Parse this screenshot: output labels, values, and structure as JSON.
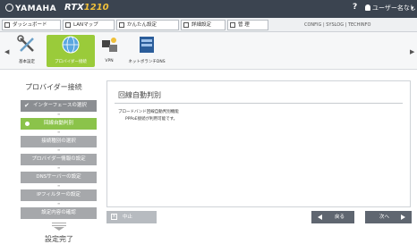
{
  "header": {
    "brand": "YAMAHA",
    "model_prefix": "RTX",
    "model_number": "1210",
    "help": "?",
    "user": "ユーザー名なし",
    "dropdown": "▾"
  },
  "tabs": [
    {
      "label": "ダッシュボード"
    },
    {
      "label": "LANマップ"
    },
    {
      "label": "かんたん設定"
    },
    {
      "label": "詳細設定"
    },
    {
      "label": "管 理"
    }
  ],
  "top_links": "CONFIG | SYSLOG | TECHINFO",
  "toolbar": {
    "items": [
      {
        "label": "基本設定",
        "icon": "wrench-screwdriver-icon"
      },
      {
        "label": "プロバイダー接続",
        "icon": "globe-icon"
      },
      {
        "label": "VPN",
        "icon": "vpn-icon"
      },
      {
        "label": "ネットボランチDNS",
        "icon": "dns-icon"
      }
    ],
    "left_arrow": "◀",
    "right_arrow": "▶"
  },
  "sidebar": {
    "title": "プロバイダー接続",
    "steps": [
      {
        "label": "インターフェースの選択",
        "status": "done"
      },
      {
        "label": "回線自動判別",
        "status": "current"
      },
      {
        "label": "接続種別の選択",
        "status": "pending"
      },
      {
        "label": "プロバイダー情報の設定",
        "status": "pending"
      },
      {
        "label": "DNSサーバーの設定",
        "status": "pending"
      },
      {
        "label": "IPフィルターの設定",
        "status": "pending"
      },
      {
        "label": "設定内容の確認",
        "status": "pending"
      }
    ],
    "finish": "設定完了",
    "separator": "≡"
  },
  "content": {
    "title": "回線自動判別",
    "subtitle": "ブロードバンド回線自動判別機能",
    "message": "PPPoE接続が利用可能です。"
  },
  "buttons": {
    "cancel": "中止",
    "back": "戻る",
    "next": "次へ"
  }
}
